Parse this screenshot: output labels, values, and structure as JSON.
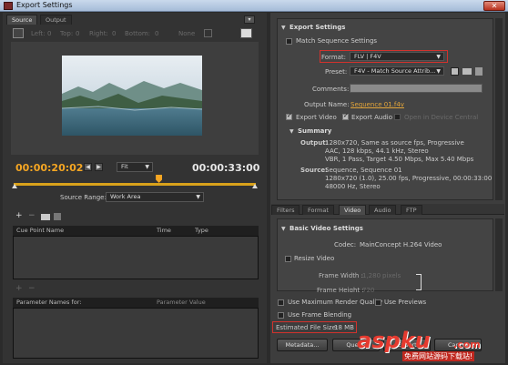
{
  "window": {
    "title": "Export Settings",
    "close_symbol": "✕"
  },
  "left": {
    "tabs": [
      "Source",
      "Output"
    ],
    "crop": {
      "left_label": "Left:",
      "left_value": "0",
      "top_label": "Top:",
      "top_value": "0",
      "right_label": "Right:",
      "right_value": "0",
      "bottom_label": "Bottom:",
      "bottom_value": "0",
      "ratio": "None"
    },
    "timecode_current": "00:00:20:02",
    "zoom": "Fit",
    "timecode_total": "00:00:33:00",
    "playhead_fraction": 0.6,
    "source_range_label": "Source Range:",
    "source_range_value": "Work Area",
    "cue_columns": [
      "Cue Point Name",
      "Time",
      "Type"
    ],
    "param_columns": [
      "Parameter Names for:",
      "Parameter Value"
    ]
  },
  "right": {
    "section_title": "Export Settings",
    "match_sequence": "Match Sequence Settings",
    "format_label": "Format:",
    "format_value": "FLV | F4V",
    "preset_label": "Preset:",
    "preset_value": "F4V - Match Source Attrib...",
    "comments_label": "Comments:",
    "output_name_label": "Output Name:",
    "output_name_value": "Sequence 01.f4v",
    "export_video": "Export Video",
    "export_audio": "Export Audio",
    "open_device": "Open in Device Central",
    "summary_title": "Summary",
    "summary_output_label": "Output:",
    "summary_output_lines": [
      "1280x720, Same as source fps, Progressive",
      "AAC, 128 kbps, 44.1 kHz, Stereo",
      "VBR, 1 Pass, Target 4.50 Mbps, Max 5.40 Mbps"
    ],
    "summary_source_label": "Source:",
    "summary_source_lines": [
      "Sequence, Sequence 01",
      "1280x720 (1.0), 25.00 fps, Progressive, 00:00:33:00",
      "48000 Hz, Stereo"
    ],
    "tabs": [
      "Filters",
      "Format",
      "Video",
      "Audio",
      "FTP"
    ],
    "basic_video_title": "Basic Video Settings",
    "codec_label": "Codec:",
    "codec_value": "MainConcept H.264 Video",
    "resize_video": "Resize Video",
    "frame_width_label": "Frame Width :",
    "frame_width_value": "1,280",
    "frame_height_label": "Frame Height :",
    "frame_height_value": "720",
    "pixels": "pixels",
    "max_render": "Use Maximum Render Quality",
    "use_previews": "Use Previews",
    "frame_blending": "Use Frame Blending",
    "est_size_label": "Estimated File Size:",
    "est_size_value": "18 MB",
    "metadata_btn": "Metadata...",
    "queue_btn": "Queue",
    "export_btn": "Export",
    "cancel_btn": "Cancel"
  },
  "watermark": {
    "brand": "aspku",
    "domain": ".com",
    "tagline": "免费网站源码下载站!"
  }
}
